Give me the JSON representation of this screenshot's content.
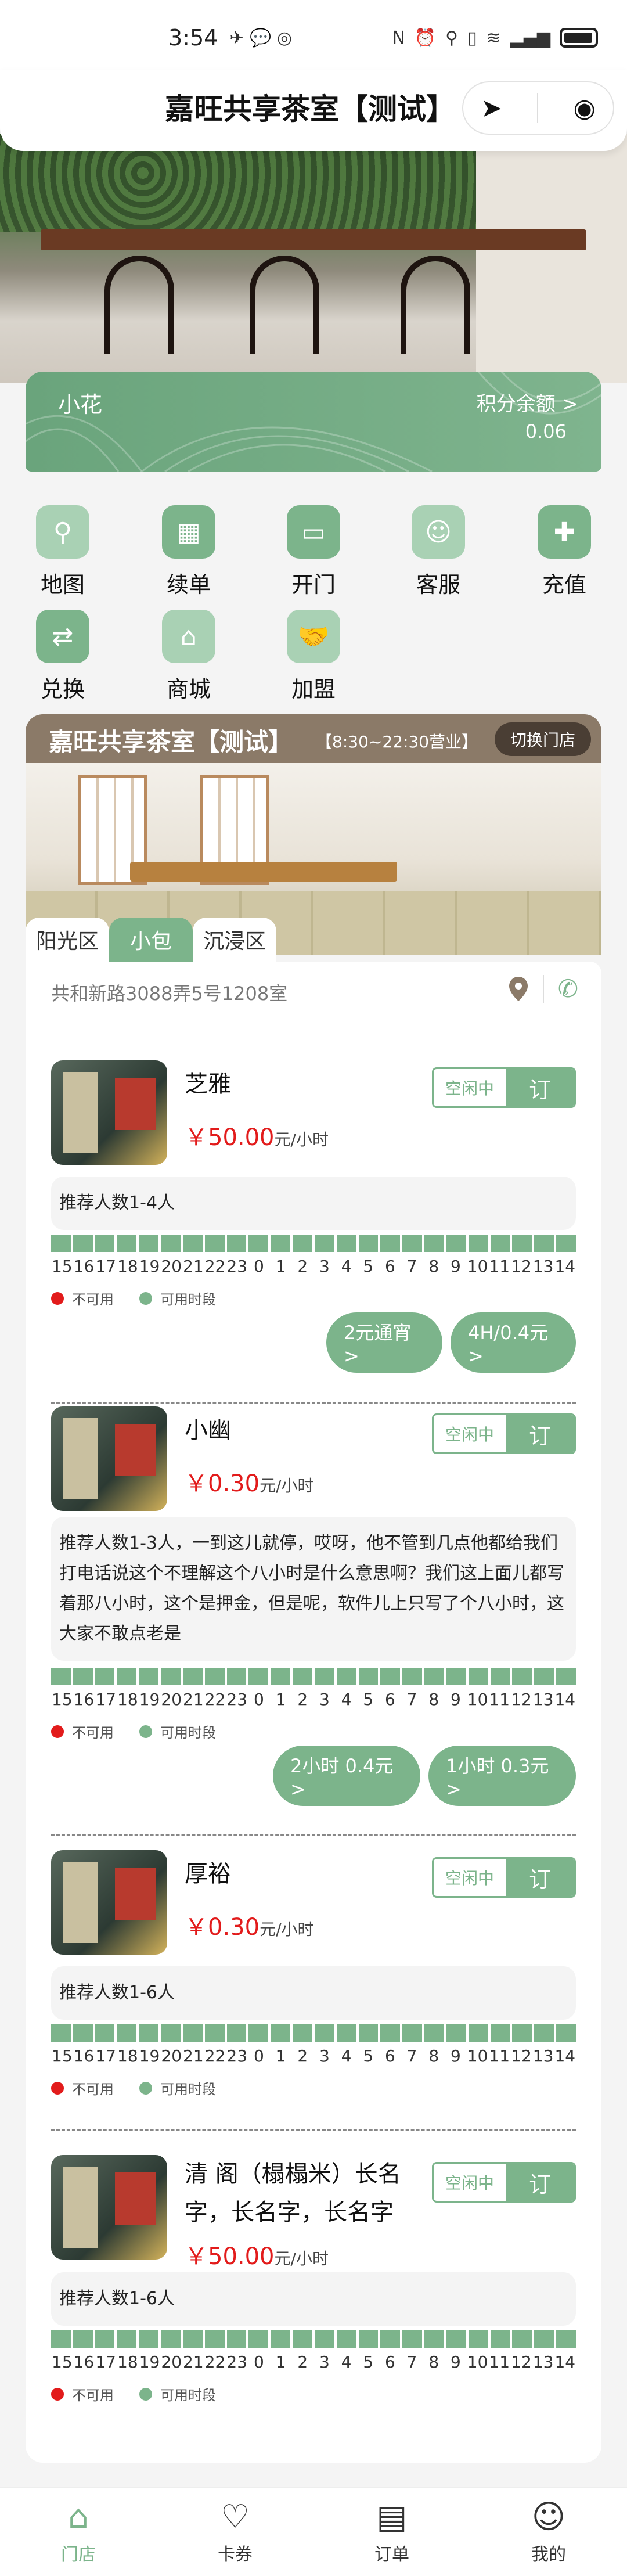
{
  "status_bar": {
    "time": "3:54",
    "battery": "battery-icon"
  },
  "header": {
    "title": "嘉旺共享茶室【测试】"
  },
  "member": {
    "name": "小花",
    "points_label": "积分余额 >",
    "points_value": "0.06"
  },
  "menu": [
    {
      "label": "地图",
      "icon": "map-icon"
    },
    {
      "label": "续单",
      "icon": "renew-icon"
    },
    {
      "label": "开门",
      "icon": "door-icon"
    },
    {
      "label": "客服",
      "icon": "service-icon"
    },
    {
      "label": "充值",
      "icon": "recharge-icon"
    },
    {
      "label": "兑换",
      "icon": "exchange-icon"
    },
    {
      "label": "商城",
      "icon": "store-icon"
    },
    {
      "label": "加盟",
      "icon": "handshake-icon"
    }
  ],
  "store": {
    "name": "嘉旺共享茶室【测试】",
    "hours": "【8:30~22:30营业】",
    "switch_label": "切换门店",
    "address": "共和新路3088弄5号1208室"
  },
  "area_tabs": [
    "阳光区",
    "小包",
    "沉浸区"
  ],
  "hours": [
    "15",
    "16",
    "17",
    "18",
    "19",
    "20",
    "21",
    "22",
    "23",
    "0",
    "1",
    "2",
    "3",
    "4",
    "5",
    "6",
    "7",
    "8",
    "9",
    "10",
    "11",
    "12",
    "13",
    "14"
  ],
  "legend": {
    "unavailable": "不可用",
    "available": "可用时段"
  },
  "rooms": [
    {
      "name": "芝雅",
      "price": "￥50.00",
      "unit": "元/小时",
      "status": "空闲中",
      "book": "订",
      "recommend": "推荐人数1-4人",
      "packages": [
        "2元通宵 >",
        "4H/0.4元 >"
      ]
    },
    {
      "name": "小幽",
      "price": "￥0.30",
      "unit": "元/小时",
      "status": "空闲中",
      "book": "订",
      "recommend": "推荐人数1-3人，一到这儿就停，哎呀，他不管到几点他都给我们打电话说这个不理解这个八小时是什么意思啊？我们这上面儿都写着那八小时，这个是押金，但是呢，软件儿上只写了个八小时，这大家不敢点老是",
      "packages": [
        "2小时 0.4元 >",
        "1小时 0.3元 >"
      ]
    },
    {
      "name": "厚裕",
      "price": "￥0.30",
      "unit": "元/小时",
      "status": "空闲中",
      "book": "订",
      "recommend": "推荐人数1-6人",
      "packages": []
    },
    {
      "name": "清 阁（榻榻米）长名字，长名字，长名字",
      "price": "￥50.00",
      "unit": "元/小时",
      "status": "空闲中",
      "book": "订",
      "recommend": "推荐人数1-6人",
      "packages": []
    }
  ],
  "bottom_nav": [
    {
      "label": "门店",
      "icon": "home-icon"
    },
    {
      "label": "卡券",
      "icon": "heart-icon"
    },
    {
      "label": "订单",
      "icon": "order-icon"
    },
    {
      "label": "我的",
      "icon": "profile-icon"
    }
  ],
  "colors": {
    "accent": "#7cb48b",
    "price": "#e21b1b",
    "store_header": "#8b7a68"
  }
}
